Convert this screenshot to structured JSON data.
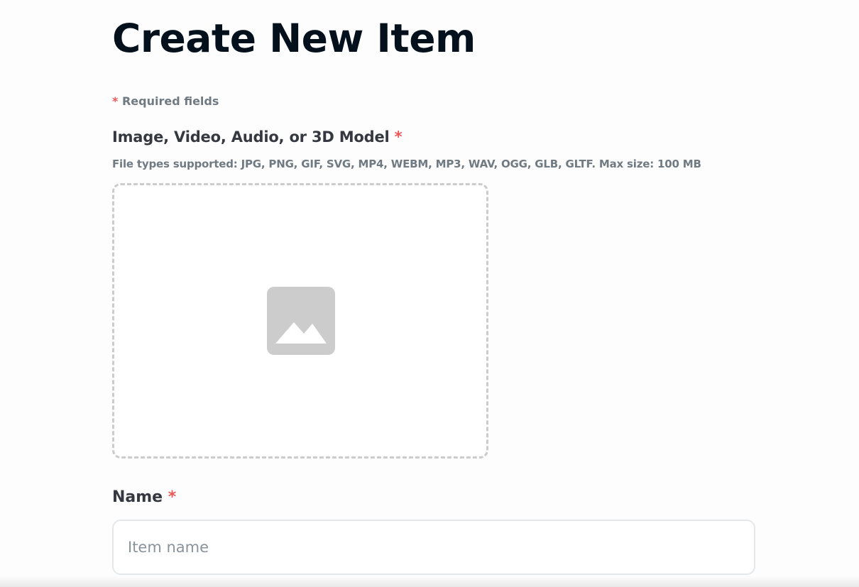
{
  "page": {
    "title": "Create New Item",
    "required_note": {
      "asterisk": "*",
      "text": "Required fields"
    }
  },
  "media_field": {
    "label": "Image, Video, Audio, or 3D Model",
    "required_mark": "*",
    "help_text": "File types supported: JPG, PNG, GIF, SVG, MP4, WEBM, MP3, WAV, OGG, GLB, GLTF. Max size: 100 MB",
    "dropzone_icon": "image-placeholder-icon"
  },
  "name_field": {
    "label": "Name",
    "required_mark": "*",
    "value": "",
    "placeholder": "Item name"
  },
  "colors": {
    "required_red": "#eb5757",
    "heading": "#04111d",
    "label": "#353840",
    "muted": "#707a83",
    "dashed_border": "#cccccc",
    "icon_gray": "#cccccc",
    "input_border": "#e5e8eb"
  }
}
